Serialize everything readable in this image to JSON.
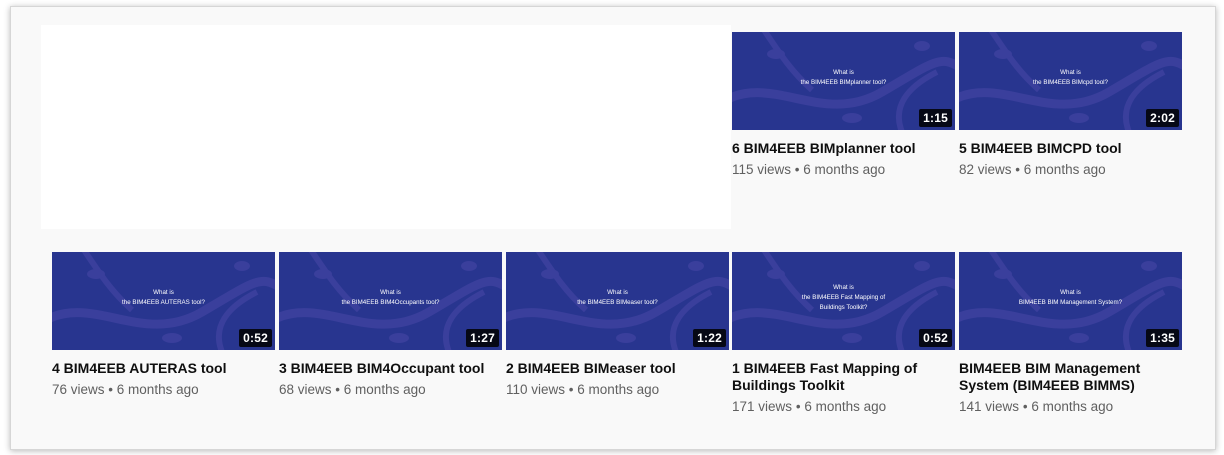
{
  "videos": [
    {
      "title": "6 BIM4EEB BIMplanner tool",
      "views": "115 views",
      "age": "6 months ago",
      "duration": "1:15",
      "thumb_text": "What is\nthe BIM4EEB BIMplanner tool?"
    },
    {
      "title": "5 BIM4EEB BIMCPD tool",
      "views": "82 views",
      "age": "6 months ago",
      "duration": "2:02",
      "thumb_text": "What is\nthe BIM4EEB BIMcpd tool?"
    },
    {
      "title": "4 BIM4EEB AUTERAS tool",
      "views": "76 views",
      "age": "6 months ago",
      "duration": "0:52",
      "thumb_text": "What is\nthe BIM4EEB AUTERAS tool?"
    },
    {
      "title": "3 BIM4EEB BIM4Occupant tool",
      "views": "68 views",
      "age": "6 months ago",
      "duration": "1:27",
      "thumb_text": "What is\nthe BIM4EEB BIM4Occupants tool?"
    },
    {
      "title": "2 BIM4EEB BIMeaser tool",
      "views": "110 views",
      "age": "6 months ago",
      "duration": "1:22",
      "thumb_text": "What is\nthe BIM4EEB BIMeaser tool?"
    },
    {
      "title": "1 BIM4EEB Fast Mapping of Buildings Toolkit",
      "views": "171 views",
      "age": "6 months ago",
      "duration": "0:52",
      "thumb_text": "What is\nthe BIM4EEB Fast Mapping of\nBuildings Toolkit?"
    },
    {
      "title": "BIM4EEB BIM Management System (BIM4EEB BIMMS)",
      "views": "141 views",
      "age": "6 months ago",
      "duration": "1:35",
      "thumb_text": "What is\nBIM4EEB BIM Management System?"
    }
  ],
  "meta_separator": "•",
  "colors": {
    "thumb_bg": "#28358f",
    "thumb_pattern": "#3a3f9c",
    "title": "#0f0f0f",
    "meta": "#606060"
  }
}
